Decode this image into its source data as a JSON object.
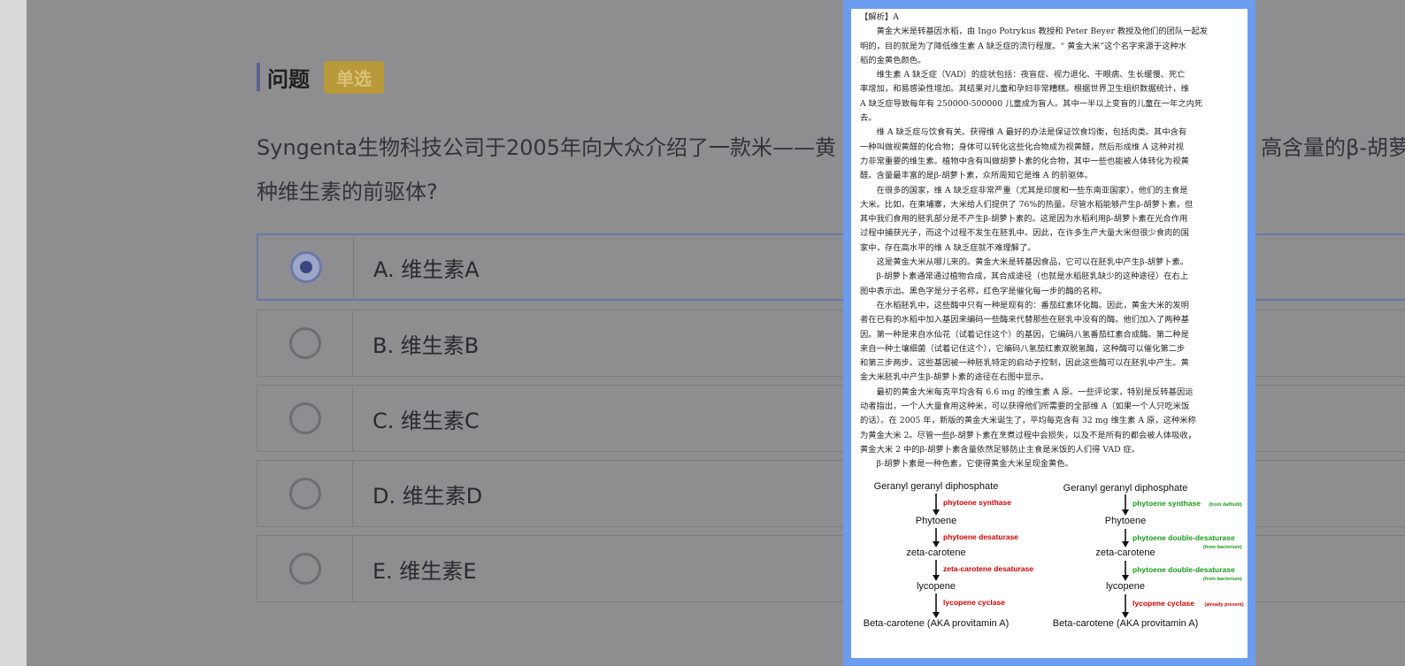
{
  "question": {
    "heading": "问题",
    "type_badge": "单选",
    "text": "Syngenta生物科技公司于2005年向大众介绍了一款米——黄",
    "text_tail": "高含量的β-胡萝",
    "text_line2": "种维生素的前驱体?"
  },
  "options": [
    {
      "label": "A. 维生素A",
      "selected": true
    },
    {
      "label": "B. 维生素B",
      "selected": false
    },
    {
      "label": "C. 维生素C",
      "selected": false
    },
    {
      "label": "D. 维生素D",
      "selected": false
    },
    {
      "label": "E. 维生素E",
      "selected": false
    }
  ],
  "explanation": {
    "header": "【解析】A",
    "paragraphs": [
      [
        "黄金大米是转基因水稻，由 Ingo Potrykus 教授和 Peter Beyer 教授及他们的团队一起发",
        "明的，目的就是为了降低维生素 A 缺乏症的流行程度。“ 黄金大米”这个名字来源于这种水",
        "稻的金黄色颜色。"
      ],
      [
        "维生素 A 缺乏症（VAD）的症状包括：夜盲症、视力退化、干眼病、生长缓慢、死亡",
        "率增加，和易感染性增加。其结果对儿童和孕妇非常糟糕。根据世界卫生组织数据统计，维",
        "A 缺乏症导致每年有 250000-500000 儿童成为盲人。其中一半以上变盲的儿童在一年之内死",
        "去。"
      ],
      [
        "维 A 缺乏症与饮食有关。获得维 A 最好的办法是保证饮食均衡，包括肉类。其中含有",
        "一种叫做视黄醛的化合物；身体可以转化这些化合物成为视黄醛，然后形成维 A 这种对视",
        "力非常重要的维生素。植物中含有叫做胡萝卜素的化合物，其中一些也能被人体转化为视黄",
        "醛。含量最丰富的是β-胡萝卜素，众所周知它是维 A 的前驱体。"
      ],
      [
        "在很多的国家，维 A 缺乏症非常严重（尤其是印度和一些东南亚国家），他们的主食是",
        "大米。比如，在柬埔寨，大米给人们提供了 76%的热量。尽管水稻能够产生β-胡萝卜素，但",
        "其中我们食用的胚乳部分是不产生β-胡萝卜素的。这是因为水稻利用β-胡萝卜素在光合作用",
        "过程中捕获光子，而这个过程不发生在胚乳中。因此，在许多生产大量大米但很少食肉的国",
        "家中，存在高水平的维 A 缺乏症就不难理解了。"
      ],
      [
        "这是黄金大米从哪儿来的。黄金大米是转基因食品，它可以在胚乳中产生β-胡萝卜素。"
      ],
      [
        "β-胡萝卜素通常通过植物合成，其合成途径（也就是水稻胚乳缺少的这种途径）在右上",
        "图中表示出。黑色字是分子名称，红色字是催化每一步的酶的名称。"
      ],
      [
        "在水稻胚乳中，这些酶中只有一种是现有的：番茄红素环化酶。因此，黄金大米的发明",
        "者在已有的水稻中加入基因来编码一些酶来代替那些在胚乳中没有的酶。他们加入了两种基",
        "因。第一种是来自水仙花（试着记住这个）的基因，它编码八氢番茄红素合成酶。第二种是",
        "来自一种土壤细菌（试着记住这个），它编码八氢茄红素双脱氢酶，这种酶可以催化第二步",
        "和第三步两步。这些基因被一种胚乳特定的启动子控制，因此这些酶可以在胚乳中产生。黄",
        "金大米胚乳中产生β-胡萝卜素的途径在右图中显示。"
      ],
      [
        "最初的黄金大米每克平均含有 6.6 mg 的维生素 A 原。一些评论家，特别是反转基因运",
        "动者指出，一个人大量食用这种米，可以获得他们所需要的全部维 A（如果一个人只吃米饭",
        "的话）。在 2005 年，新版的黄金大米诞生了，平均每克含有 32 mg 维生素 A 原，这种米称",
        "为黄金大米 2。尽管一些β-胡萝卜素在烹煮过程中会损失，以及不是所有的都会被人体吸收，",
        "黄金大米 2 中的β-胡萝卜素含量依然足够防止主食是米饭的人们得 VAD 症。"
      ],
      [
        "β-胡萝卜素是一种色素，它使得黄金大米呈现金黄色。"
      ]
    ]
  },
  "pathway_left": {
    "nodes": [
      "Geranyl geranyl diphosphate",
      "Phytoene",
      "zeta-carotene",
      "lycopene",
      "Beta-carotene (AKA provitamin A)"
    ],
    "enzymes": [
      "phytoene synthase",
      "phytoene desaturase",
      "zeta-carotene desaturase",
      "lycopene cyclase"
    ]
  },
  "pathway_right": {
    "nodes": [
      "Geranyl geranyl diphosphate",
      "Phytoene",
      "zeta-carotene",
      "lycopene",
      "Beta-carotene (AKA provitamin A)"
    ],
    "enzymes": [
      "phytoene synthase",
      "phytoene double-desaturase",
      "phytoene double-desaturase",
      "lycopene cyclase"
    ],
    "sources": [
      "(from daffodil)",
      "(from bacterium)",
      "(from bacterium)",
      "(already present)"
    ]
  },
  "colors": {
    "enzyme_red": "#d00000",
    "enzyme_green": "#1a9a1a",
    "popup_border": "#6a9cf0",
    "selected": "#3b4680",
    "badge": "#b99a3a"
  }
}
